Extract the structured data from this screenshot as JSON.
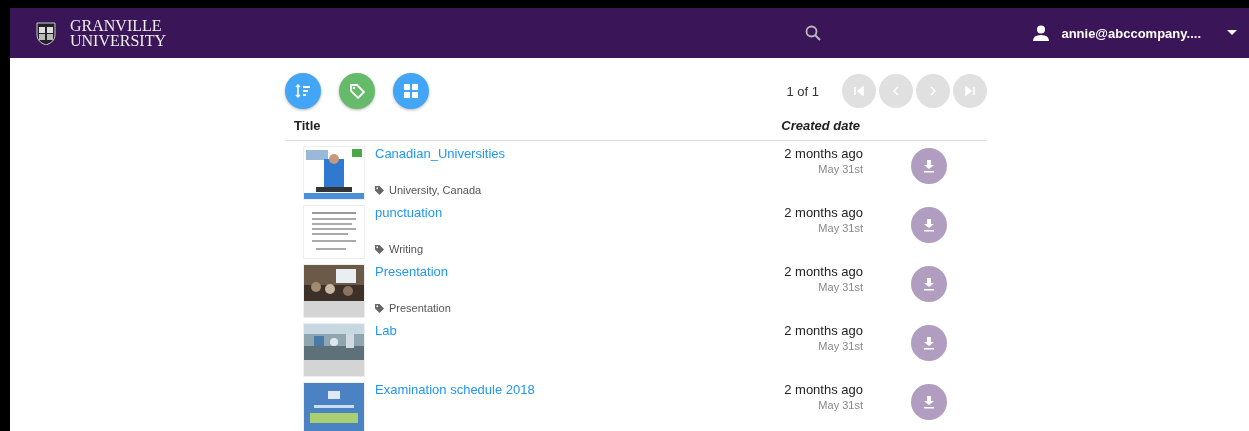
{
  "header": {
    "brand_line_1": "GRANVILLE",
    "brand_line_2": "UNIVERSITY",
    "user": "annie@abccompany...."
  },
  "toolbar": {
    "page_info": "1 of 1",
    "pager_disabled": true
  },
  "table": {
    "columns": [
      "Title",
      "Created date"
    ],
    "rows": [
      {
        "title": "Canadian_Universities",
        "tags": "University, Canada",
        "created": "2 months ago",
        "date": "May 31st"
      },
      {
        "title": "punctuation",
        "tags": "Writing",
        "created": "2 months ago",
        "date": "May 31st"
      },
      {
        "title": "Presentation",
        "tags": "Presentation",
        "created": "2 months ago",
        "date": "May 31st"
      },
      {
        "title": "Lab",
        "created": "2 months ago",
        "date": "May 31st"
      },
      {
        "title": "Examination schedule 2018",
        "created": "2 months ago",
        "date": "May 31st"
      }
    ]
  }
}
